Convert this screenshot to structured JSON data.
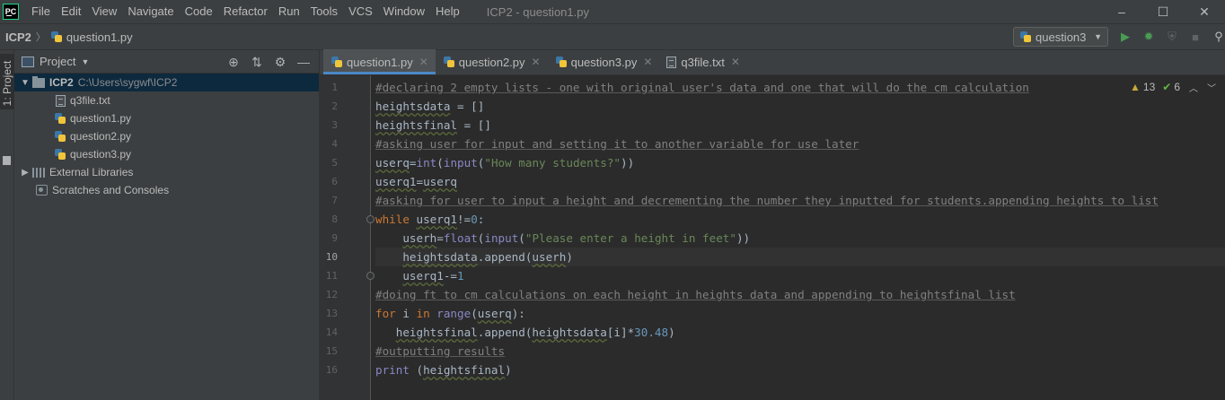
{
  "app": {
    "logo_text": "PC",
    "window_title": "ICP2 - question1.py"
  },
  "menu": [
    "File",
    "Edit",
    "View",
    "Navigate",
    "Code",
    "Refactor",
    "Run",
    "Tools",
    "VCS",
    "Window",
    "Help"
  ],
  "window_controls": {
    "minimize": "–",
    "maximize": "☐",
    "close": "✕"
  },
  "breadcrumb": {
    "project": "ICP2",
    "file": "question1.py"
  },
  "run_config": {
    "name": "question3"
  },
  "toolbar": {
    "run": "▶",
    "debug": "✹",
    "coverage": "⛨",
    "stop": "■",
    "search": "⚲"
  },
  "project_panel": {
    "strip_label": "1: Project",
    "title": "Project",
    "tree": [
      {
        "label": "ICP2",
        "path": "C:\\Users\\sygwf\\ICP2",
        "type": "folder",
        "expanded": true
      },
      {
        "label": "q3file.txt",
        "type": "txt"
      },
      {
        "label": "question1.py",
        "type": "py"
      },
      {
        "label": "question2.py",
        "type": "py"
      },
      {
        "label": "question3.py",
        "type": "py"
      },
      {
        "label": "External Libraries",
        "type": "lib"
      },
      {
        "label": "Scratches and Consoles",
        "type": "scratch"
      }
    ]
  },
  "editor": {
    "tabs": [
      "question1.py",
      "question2.py",
      "question3.py",
      "q3file.txt"
    ],
    "active_tab": "question1.py",
    "current_line": 10,
    "inspections": {
      "warnings": "13",
      "weak_warnings": "6"
    },
    "lines": [
      "#declaring 2 empty lists - one with original user's data and one that will do the cm calculation",
      "heightsdata = []",
      "heightsfinal = []",
      "#asking user for input and setting it to another variable for use later",
      "userq=int(input(\"How many students?\"))",
      "userq1=userq",
      "#asking for user to input a height and decrementing the number they inputted for students.appending heights to list",
      "while userq1!=0:",
      "    userh=float(input(\"Please enter a height in feet\"))",
      "    heightsdata.append(userh)",
      "    userq1-=1",
      "#doing ft to cm calculations on each height in heights data and appending to heightsfinal list",
      "for i in range(userq):",
      "   heightsfinal.append(heightsdata[i]*30.48)",
      "#outputting results",
      "print (heightsfinal)"
    ],
    "line_numbers": [
      "1",
      "2",
      "3",
      "4",
      "5",
      "6",
      "7",
      "8",
      "9",
      "10",
      "11",
      "12",
      "13",
      "14",
      "15",
      "16"
    ]
  }
}
